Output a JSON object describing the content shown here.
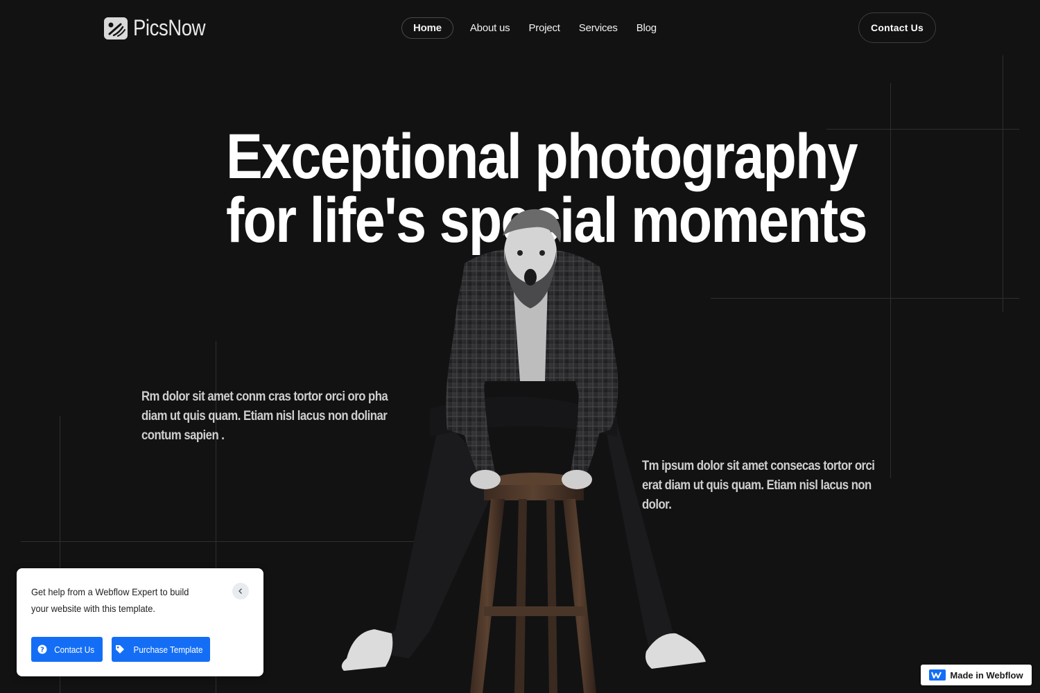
{
  "brand": {
    "name": "PicsNow",
    "logo_icon": "camera-lens-icon"
  },
  "nav": {
    "items": [
      {
        "label": "Home",
        "active": true
      },
      {
        "label": "About us",
        "active": false
      },
      {
        "label": "Project",
        "active": false
      },
      {
        "label": "Services",
        "active": false
      },
      {
        "label": "Blog",
        "active": false
      }
    ],
    "contact_label": "Contact Us"
  },
  "hero": {
    "title_line1": "Exceptional photography",
    "title_line2": "for life's special moments",
    "image": "man-on-wooden-stool-photo",
    "para_left": "Rm dolor sit amet conm cras tortor orci oro pha diam ut quis quam. Etiam nisl lacus non dolinar contum sapien .",
    "para_right": "Tm ipsum dolor sit amet consecas tortor orci erat diam ut quis quam. Etiam nisl lacus non dolor."
  },
  "webflow_popup": {
    "text": "Get help from a Webflow Expert to build your website with this template.",
    "close_icon": "chevron-left-icon",
    "contact_label": "Contact Us",
    "contact_icon": "question-circle-icon",
    "purchase_label": "Purchase Template",
    "purchase_icon": "tag-icon"
  },
  "webflow_badge": {
    "label": "Made in Webflow",
    "icon": "webflow-logo-icon"
  },
  "colors": {
    "background": "#121213",
    "accent": "#146ef5",
    "text": "#ffffff"
  }
}
